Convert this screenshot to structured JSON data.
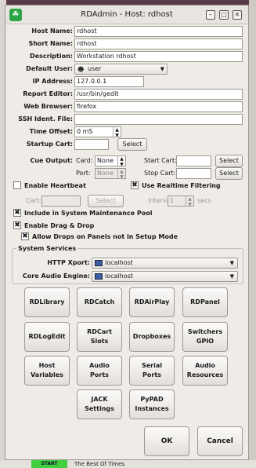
{
  "window": {
    "title": "RDAdmin - Host: rdhost",
    "app_icon_glyph": "☘",
    "controls": {
      "minimize": "–",
      "maximize": "□",
      "close": "✕"
    }
  },
  "background": {
    "start_label": "START",
    "bottom_text": "The Best Of Times"
  },
  "form": {
    "host_name": {
      "label": "Host Name:",
      "value": "rdhost"
    },
    "short_name": {
      "label": "Short Name:",
      "value": "rdhost"
    },
    "description": {
      "label": "Description:",
      "value": "Workstation rdhost"
    },
    "default_user": {
      "label": "Default User:",
      "value": "user"
    },
    "ip_address": {
      "label": "IP Address:",
      "value": "127.0.0.1"
    },
    "report_editor": {
      "label": "Report Editor:",
      "value": "/usr/bin/gedit"
    },
    "web_browser": {
      "label": "Web Browser:",
      "value": "firefox"
    },
    "ssh_ident": {
      "label": "SSH Ident. File:",
      "value": ""
    },
    "time_offset": {
      "label": "Time Offset:",
      "value": "0 mS"
    },
    "startup_cart": {
      "label": "Startup Cart:",
      "value": "",
      "select": "Select"
    },
    "cue_output": {
      "label": "Cue Output:",
      "card_label": "Card:",
      "card_value": "None",
      "port_label": "Port:",
      "port_value": "None",
      "start_cart_label": "Start Cart:",
      "start_cart_select": "Select",
      "stop_cart_label": "Stop Cart:",
      "stop_cart_select": "Select"
    },
    "heartbeat": {
      "label": "Enable Heartbeat",
      "cart_label": "Cart:",
      "select": "Select",
      "interval_label": "Interval:",
      "interval_value": "1",
      "interval_unit": "secs"
    },
    "realtime_filtering": "Use Realtime Filtering",
    "system_maintenance": "Include in System Maintenance Pool",
    "drag_drop": "Enable Drag & Drop",
    "allow_drops": "Allow Drops on Panels not in Setup Mode"
  },
  "system_services": {
    "title": "System Services",
    "http_xport": {
      "label": "HTTP Xport:",
      "value": "localhost"
    },
    "core_audio": {
      "label": "Core Audio Engine:",
      "value": "localhost"
    }
  },
  "module_buttons": [
    "RDLibrary",
    "RDCatch",
    "RDAirPlay",
    "RDPanel",
    "RDLogEdit",
    "RDCart\nSlots",
    "Dropboxes",
    "Switchers\nGPIO",
    "Host\nVariables",
    "Audio\nPorts",
    "Serial\nPorts",
    "Audio\nResources",
    "JACK\nSettings",
    "PyPAD\nInstances"
  ],
  "dialog_buttons": {
    "ok": "OK",
    "cancel": "Cancel"
  }
}
